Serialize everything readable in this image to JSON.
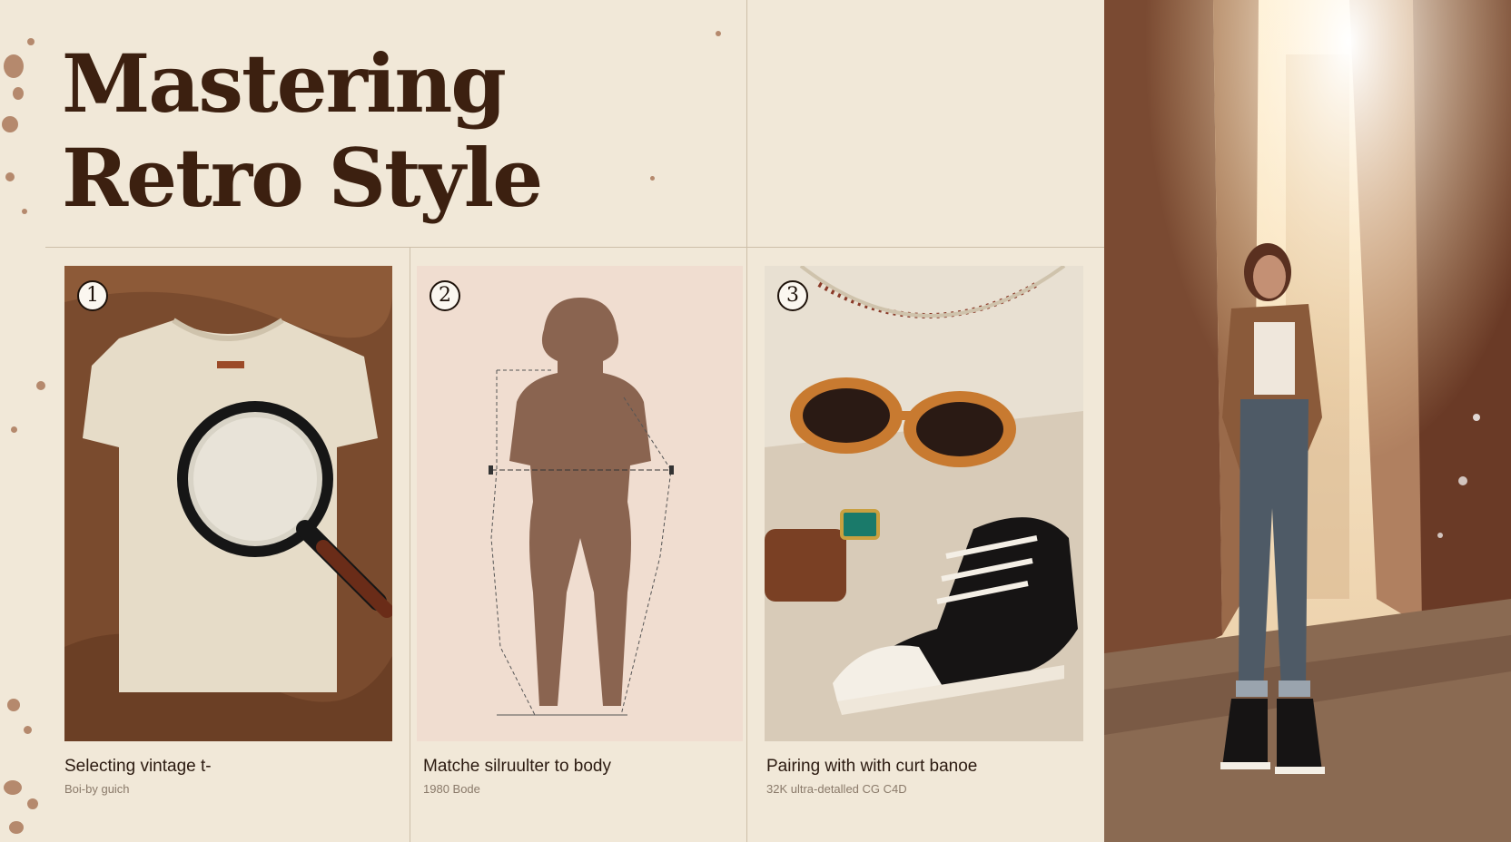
{
  "page": {
    "title_line1": "Mastering",
    "title_line2": "Retro Style"
  },
  "steps": [
    {
      "number": "1",
      "caption": "Selecting vintage t-",
      "subcaption": "Boi-by guich",
      "image": "cream t-shirt with magnifying glass on brown knit fabric"
    },
    {
      "number": "2",
      "caption": "Matche silruulter to body",
      "subcaption": "1980 Bode",
      "image": "female body silhouette with measurement lines"
    },
    {
      "number": "3",
      "caption": "Pairing with with curt banoe",
      "subcaption": "32K ultra-detalled CG C4D",
      "image": "t-shirt with amber sunglasses, leather wallet and black canvas sneaker"
    }
  ],
  "hero_image": "woman in plaid shirt and cuffed jeans standing in sunlit street",
  "colors": {
    "background": "#f1e8d8",
    "title": "#3c2010",
    "accent_brown": "#a06a4a",
    "divider": "#cdbfa9"
  }
}
